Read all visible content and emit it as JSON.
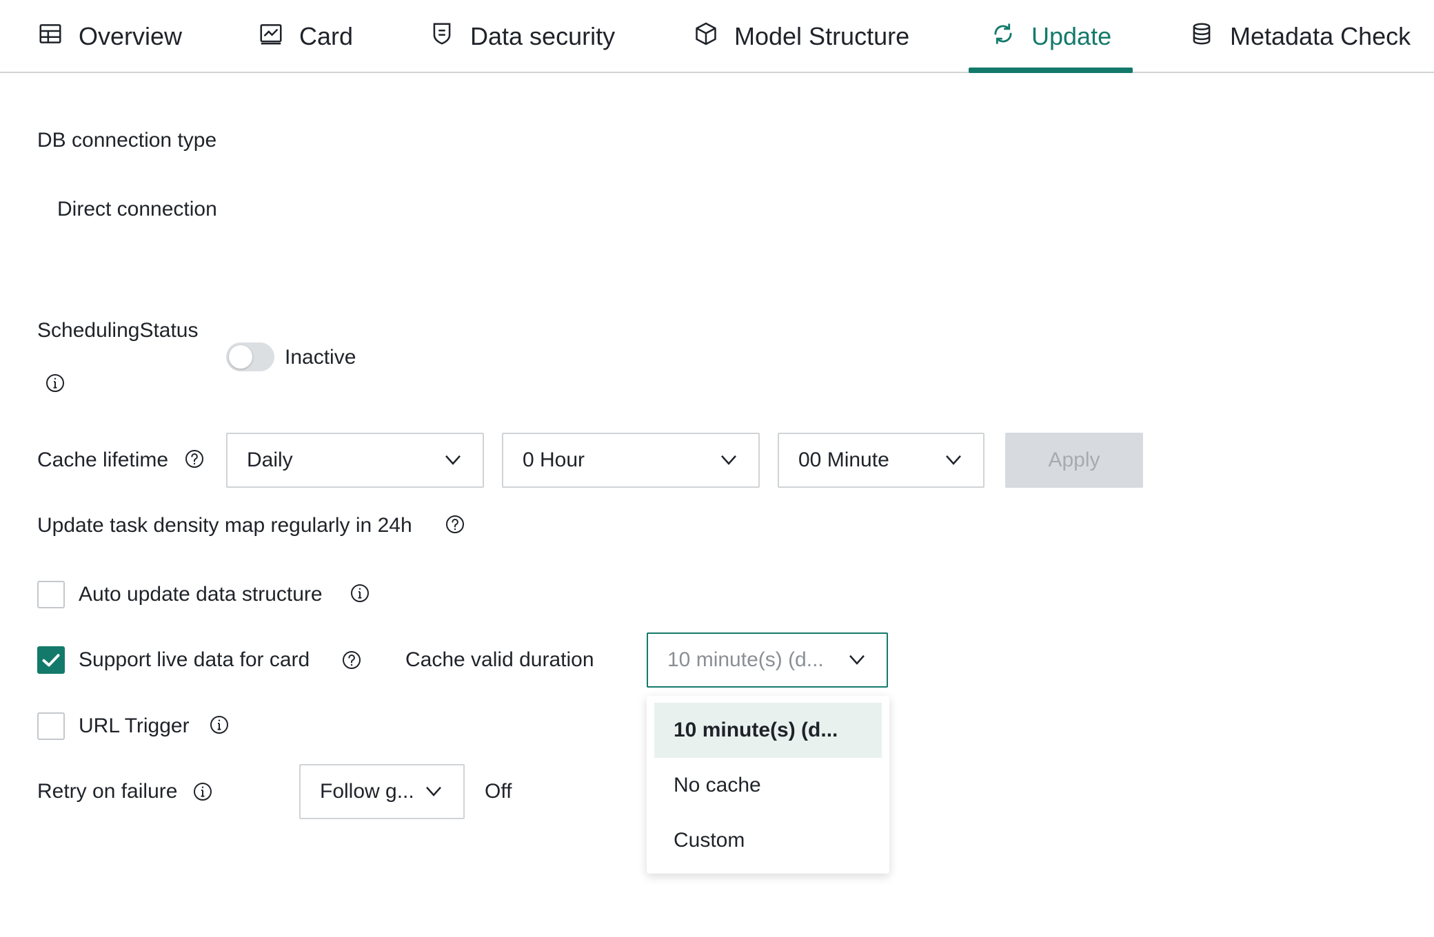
{
  "tabs": [
    {
      "label": "Overview",
      "icon": "table-icon"
    },
    {
      "label": "Card",
      "icon": "chart-card-icon"
    },
    {
      "label": "Data security",
      "icon": "shield-icon"
    },
    {
      "label": "Model Structure",
      "icon": "cube-icon"
    },
    {
      "label": "Update",
      "icon": "refresh-icon",
      "active": true
    },
    {
      "label": "Metadata Check",
      "icon": "database-icon"
    }
  ],
  "colors": {
    "accent": "#137a6b",
    "border": "#d0d3d6",
    "disabled_bg": "#d7dbdf"
  },
  "db_connection": {
    "label": "DB connection type",
    "value": "Direct connection"
  },
  "scheduling": {
    "label": "SchedulingStatus",
    "status_text": "Inactive",
    "enabled": false
  },
  "cache_lifetime": {
    "label": "Cache lifetime",
    "frequency": "Daily",
    "hour": "0 Hour",
    "minute": "00 Minute",
    "apply_label": "Apply"
  },
  "density_map": {
    "label": "Update task density map regularly in 24h"
  },
  "auto_update": {
    "label": "Auto update data structure",
    "checked": false
  },
  "live_data": {
    "label": "Support live data for card",
    "checked": true,
    "cache_valid_label": "Cache valid duration",
    "cache_valid_value": "10 minute(s) (d...",
    "options": [
      "10 minute(s) (d...",
      "No cache",
      "Custom"
    ],
    "selected_option": "10 minute(s) (d..."
  },
  "url_trigger": {
    "label": "URL Trigger",
    "checked": false
  },
  "retry": {
    "label": "Retry on failure",
    "value": "Follow g...",
    "status_text": "Off"
  }
}
